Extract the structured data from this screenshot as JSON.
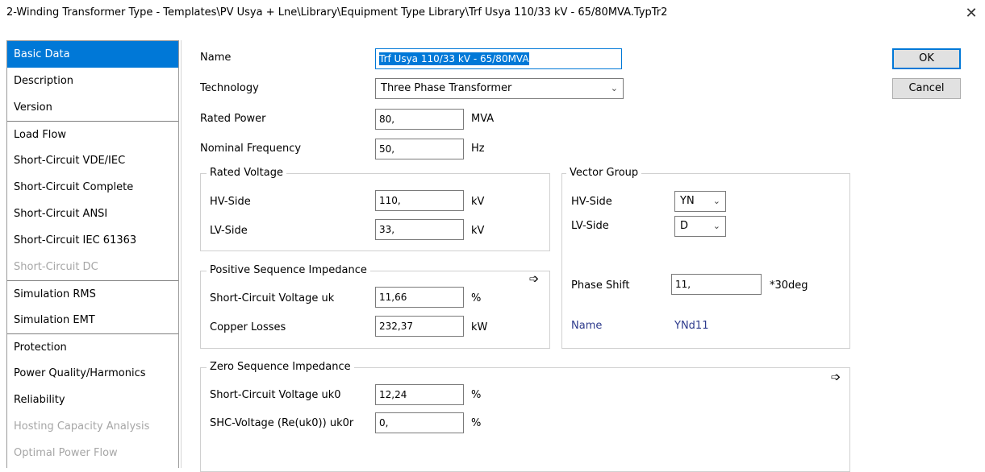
{
  "window": {
    "title": "2-Winding Transformer Type - Templates\\PV Usya + Lne\\Library\\Equipment Type Library\\Trf Usya 110/33 kV - 65/80MVA.TypTr2",
    "close_glyph": "✕"
  },
  "sidebar": {
    "items": [
      {
        "label": "Basic Data",
        "state": "active"
      },
      {
        "label": "Description",
        "state": "normal"
      },
      {
        "label": "Version",
        "state": "normal"
      },
      {
        "label": "Load Flow",
        "state": "normal"
      },
      {
        "label": "Short-Circuit VDE/IEC",
        "state": "normal"
      },
      {
        "label": "Short-Circuit Complete",
        "state": "normal"
      },
      {
        "label": "Short-Circuit ANSI",
        "state": "normal"
      },
      {
        "label": "Short-Circuit IEC 61363",
        "state": "normal"
      },
      {
        "label": "Short-Circuit DC",
        "state": "disabled"
      },
      {
        "label": "Simulation RMS",
        "state": "normal"
      },
      {
        "label": "Simulation EMT",
        "state": "normal"
      },
      {
        "label": "Protection",
        "state": "normal"
      },
      {
        "label": "Power Quality/Harmonics",
        "state": "normal"
      },
      {
        "label": "Reliability",
        "state": "normal"
      },
      {
        "label": "Hosting Capacity Analysis",
        "state": "disabled"
      },
      {
        "label": "Optimal Power Flow",
        "state": "disabled"
      }
    ]
  },
  "basic": {
    "name_label": "Name",
    "name_value": "Trf Usya 110/33 kV - 65/80MVA",
    "technology_label": "Technology",
    "technology_value": "Three Phase Transformer",
    "rated_power_label": "Rated Power",
    "rated_power_value": "80,",
    "rated_power_unit": "MVA",
    "frequency_label": "Nominal Frequency",
    "frequency_value": "50,",
    "frequency_unit": "Hz"
  },
  "rated_voltage": {
    "title": "Rated Voltage",
    "hv_label": "HV-Side",
    "hv_value": "110,",
    "hv_unit": "kV",
    "lv_label": "LV-Side",
    "lv_value": "33,",
    "lv_unit": "kV"
  },
  "positive_seq": {
    "title": "Positive Sequence Impedance",
    "uk_label": "Short-Circuit Voltage uk",
    "uk_value": "11,66",
    "uk_unit": "%",
    "cu_label": "Copper Losses",
    "cu_value": "232,37",
    "cu_unit": "kW"
  },
  "zero_seq": {
    "title": "Zero Sequence Impedance",
    "uk0_label": "Short-Circuit Voltage uk0",
    "uk0_value": "12,24",
    "uk0_unit": "%",
    "uk0r_label": "SHC-Voltage (Re(uk0)) uk0r",
    "uk0r_value": "0,",
    "uk0r_unit": "%"
  },
  "vector_group": {
    "title": "Vector Group",
    "hv_label": "HV-Side",
    "hv_value": "YN",
    "lv_label": "LV-Side",
    "lv_value": "D",
    "phase_label": "Phase Shift",
    "phase_value": "11,",
    "phase_unit": "*30deg",
    "name_label": "Name",
    "name_value": "YNd11"
  },
  "buttons": {
    "ok": "OK",
    "cancel": "Cancel"
  },
  "colors": {
    "accent": "#0078d7",
    "name_text": "#2d3a8c",
    "disabled_text": "#a6a6a6"
  }
}
